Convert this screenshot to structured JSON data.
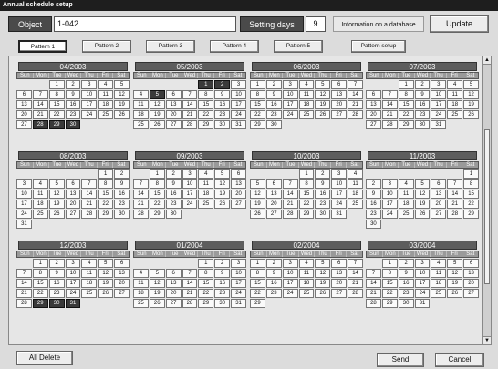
{
  "window": {
    "title": "Annual schedule setup"
  },
  "header": {
    "object_label": "Object",
    "object_value": "1-042",
    "setting_days_label": "Setting days",
    "setting_days_value": "9",
    "info_text": "Information on a database",
    "update_label": "Update"
  },
  "tabs": [
    "Pattern 1",
    "Pattern 2",
    "Pattern 3",
    "Pattern 4",
    "Pattern 5",
    "Pattern setup"
  ],
  "active_tab": 0,
  "weekdays": [
    "Sun",
    "Mon",
    "Tue",
    "Wed",
    "Thu",
    "Fri",
    "Sat"
  ],
  "months": [
    {
      "label": "04/2003",
      "start": 2,
      "days": 30,
      "selected": [
        28,
        29,
        30
      ]
    },
    {
      "label": "05/2003",
      "start": 4,
      "days": 31,
      "selected": [
        1,
        2,
        5
      ]
    },
    {
      "label": "06/2003",
      "start": 0,
      "days": 30,
      "selected": []
    },
    {
      "label": "07/2003",
      "start": 2,
      "days": 31,
      "selected": []
    },
    {
      "label": "08/2003",
      "start": 5,
      "days": 31,
      "selected": []
    },
    {
      "label": "09/2003",
      "start": 1,
      "days": 30,
      "selected": []
    },
    {
      "label": "10/2003",
      "start": 3,
      "days": 31,
      "selected": []
    },
    {
      "label": "11/2003",
      "start": 6,
      "days": 30,
      "selected": []
    },
    {
      "label": "12/2003",
      "start": 1,
      "days": 31,
      "selected": [
        29,
        30,
        31
      ]
    },
    {
      "label": "01/2004",
      "start": 4,
      "days": 31,
      "selected": []
    },
    {
      "label": "02/2004",
      "start": 0,
      "days": 29,
      "selected": []
    },
    {
      "label": "03/2004",
      "start": 1,
      "days": 31,
      "selected": []
    }
  ],
  "footer": {
    "all_delete_label": "All Delete",
    "send_label": "Send",
    "cancel_label": "Cancel"
  },
  "scrollbar": {
    "up": "▲",
    "down": "▼"
  }
}
